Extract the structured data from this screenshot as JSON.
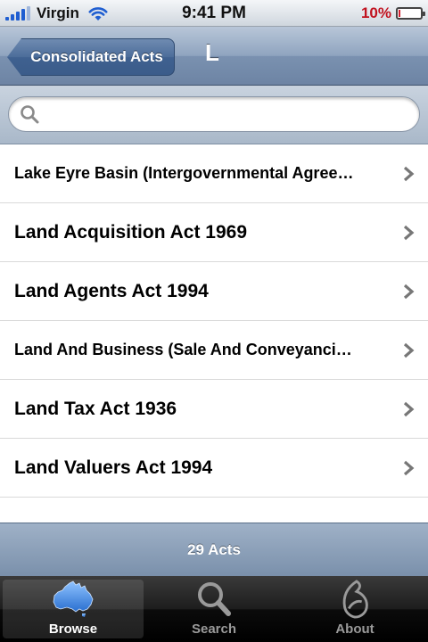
{
  "status_bar": {
    "carrier": "Virgin",
    "time": "9:41 PM",
    "battery_percent": "10%",
    "battery_level": 0.1,
    "battery_color": "#d32030"
  },
  "nav": {
    "back_label": "Consolidated Acts",
    "title": "L"
  },
  "search": {
    "placeholder": "",
    "value": ""
  },
  "acts": [
    {
      "label": "Lake Eyre Basin (Intergovernmental Agree…"
    },
    {
      "label": "Land Acquisition Act 1969"
    },
    {
      "label": "Land Agents Act 1994"
    },
    {
      "label": "Land And Business (Sale And Conveyanci…"
    },
    {
      "label": "Land Tax Act 1936"
    },
    {
      "label": "Land Valuers Act 1994"
    }
  ],
  "footer": {
    "count_label": "29 Acts"
  },
  "tabs": [
    {
      "label": "Browse",
      "icon": "australia-map-icon",
      "active": true
    },
    {
      "label": "Search",
      "icon": "magnifier-icon",
      "active": false
    },
    {
      "label": "About",
      "icon": "about-logo-icon",
      "active": false
    }
  ],
  "colors": {
    "nav_blue": "#6d84a4",
    "tab_active": "#ffffff",
    "tab_inactive": "#9a9a9a",
    "map_blue": "#3a86e0"
  }
}
